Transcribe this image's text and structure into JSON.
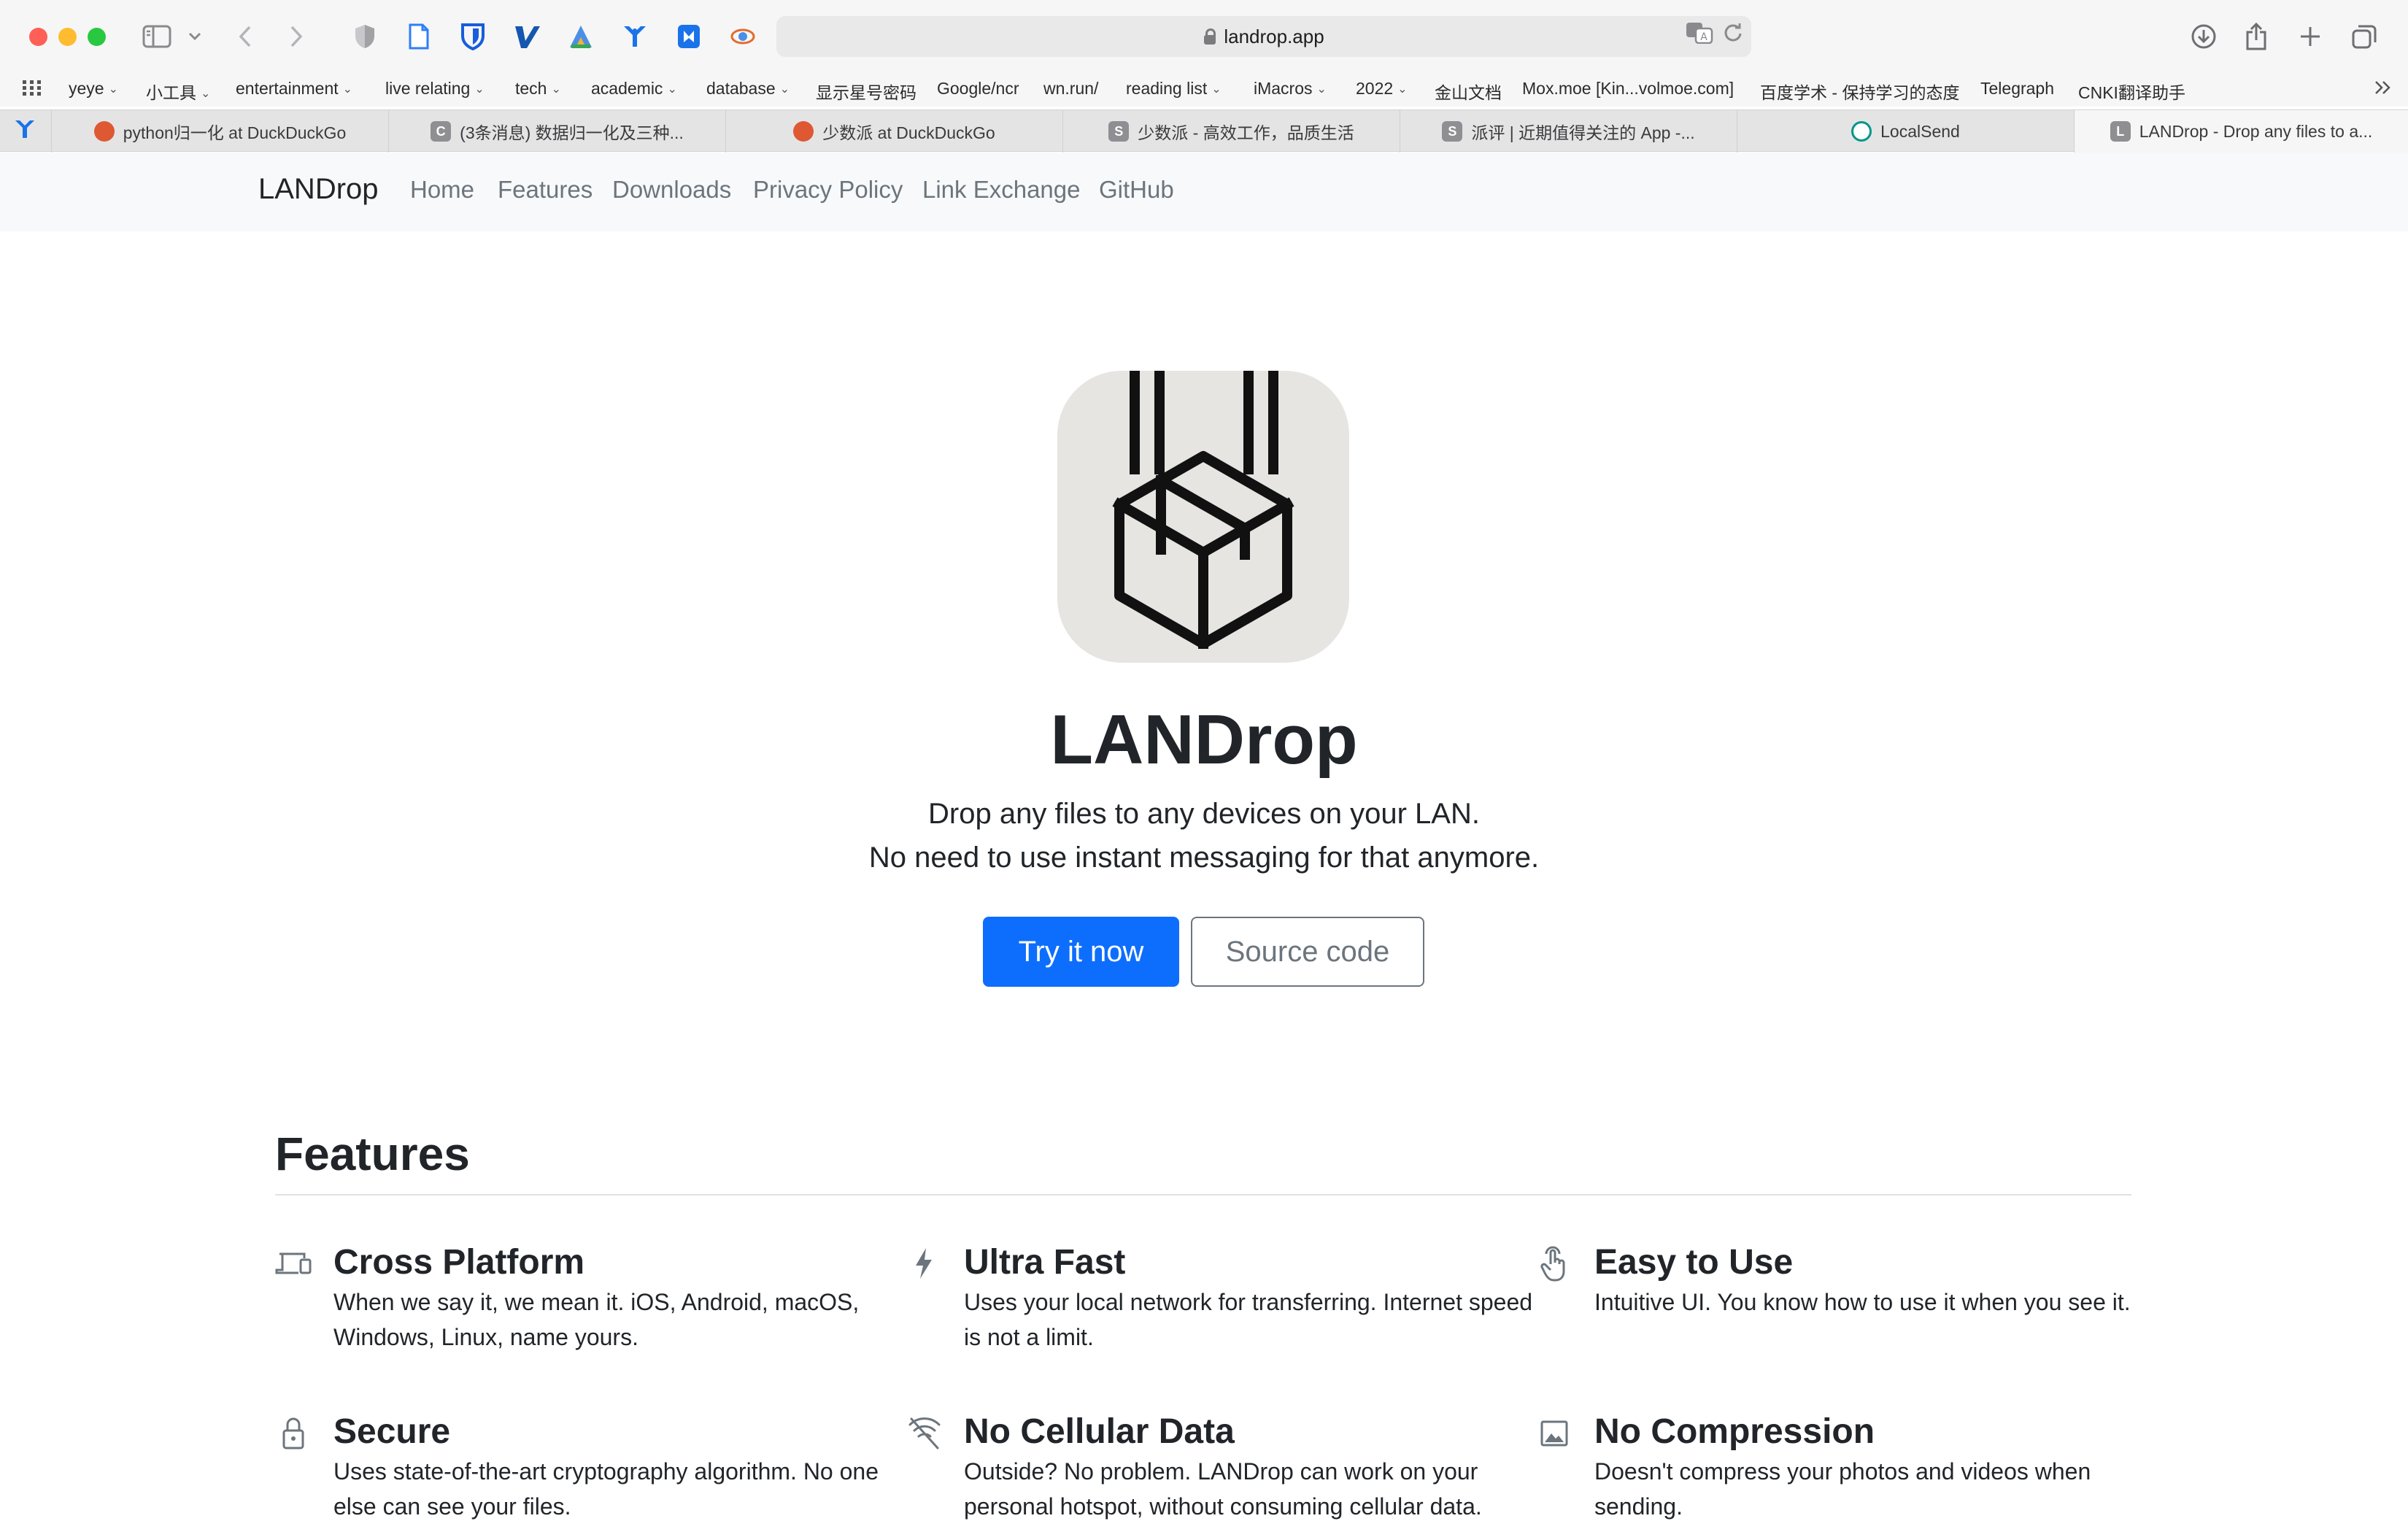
{
  "browser": {
    "url": "landrop.app",
    "bookmarks": [
      {
        "label": "yeye",
        "folder": true
      },
      {
        "label": "小工具",
        "folder": true
      },
      {
        "label": "entertainment",
        "folder": true
      },
      {
        "label": "live relating",
        "folder": true
      },
      {
        "label": "tech",
        "folder": true
      },
      {
        "label": "academic",
        "folder": true
      },
      {
        "label": "database",
        "folder": true
      },
      {
        "label": "显示星号密码",
        "folder": false
      },
      {
        "label": "Google/ncr",
        "folder": false
      },
      {
        "label": "wn.run/",
        "folder": false
      },
      {
        "label": "reading list",
        "folder": true
      },
      {
        "label": "iMacros",
        "folder": true
      },
      {
        "label": "2022",
        "folder": true
      },
      {
        "label": "金山文档",
        "folder": false
      },
      {
        "label": "Mox.moe [Kin...volmoe.com]",
        "folder": false
      },
      {
        "label": "百度学术 - 保持学习的态度",
        "folder": false
      },
      {
        "label": "Telegraph",
        "folder": false
      },
      {
        "label": "CNKI翻译助手",
        "folder": false
      }
    ],
    "tabs": [
      {
        "title": "python归一化 at DuckDuckGo",
        "favicon": "duckduckgo-icon",
        "fav_letter": "",
        "fav_color": "#de5833",
        "active": false
      },
      {
        "title": "(3条消息) 数据归一化及三种...",
        "favicon": "csdn-icon",
        "fav_letter": "C",
        "fav_color": "#8e8e93",
        "active": false
      },
      {
        "title": "少数派 at DuckDuckGo",
        "favicon": "duckduckgo-icon",
        "fav_letter": "",
        "fav_color": "#de5833",
        "active": false
      },
      {
        "title": "少数派 - 高效工作，品质生活",
        "favicon": "sspai-icon",
        "fav_letter": "S",
        "fav_color": "#8e8e93",
        "active": false
      },
      {
        "title": "派评 | 近期值得关注的 App -...",
        "favicon": "sspai-icon",
        "fav_letter": "S",
        "fav_color": "#8e8e93",
        "active": false
      },
      {
        "title": "LocalSend",
        "favicon": "localsend-icon",
        "fav_letter": "",
        "fav_color": "#009688",
        "active": false
      },
      {
        "title": "LANDrop - Drop any files to a...",
        "favicon": "landrop-icon",
        "fav_letter": "L",
        "fav_color": "#8e8e93",
        "active": true
      }
    ]
  },
  "nav": {
    "brand": "LANDrop",
    "links": [
      "Home",
      "Features",
      "Downloads",
      "Privacy Policy",
      "Link Exchange",
      "GitHub"
    ]
  },
  "hero": {
    "title": "LANDrop",
    "subtitle_line1": "Drop any files to any devices on your LAN.",
    "subtitle_line2": "No need to use instant messaging for that anymore.",
    "primary_button": "Try it now",
    "secondary_button": "Source code"
  },
  "features": {
    "heading": "Features",
    "items": [
      {
        "icon": "devices-icon",
        "title": "Cross Platform",
        "text": "When we say it, we mean it. iOS, Android, macOS, Windows, Linux, name yours."
      },
      {
        "icon": "lightning-icon",
        "title": "Ultra Fast",
        "text": "Uses your local network for transferring. Internet speed is not a limit."
      },
      {
        "icon": "hand-pointer-icon",
        "title": "Easy to Use",
        "text": "Intuitive UI. You know how to use it when you see it."
      },
      {
        "icon": "lock-icon",
        "title": "Secure",
        "text": "Uses state-of-the-art cryptography algorithm. No one else can see your files."
      },
      {
        "icon": "no-signal-icon",
        "title": "No Cellular Data",
        "text": "Outside? No problem. LANDrop can work on your personal hotspot, without consuming cellular data."
      },
      {
        "icon": "image-icon",
        "title": "No Compression",
        "text": "Doesn't compress your photos and videos when sending."
      }
    ]
  }
}
